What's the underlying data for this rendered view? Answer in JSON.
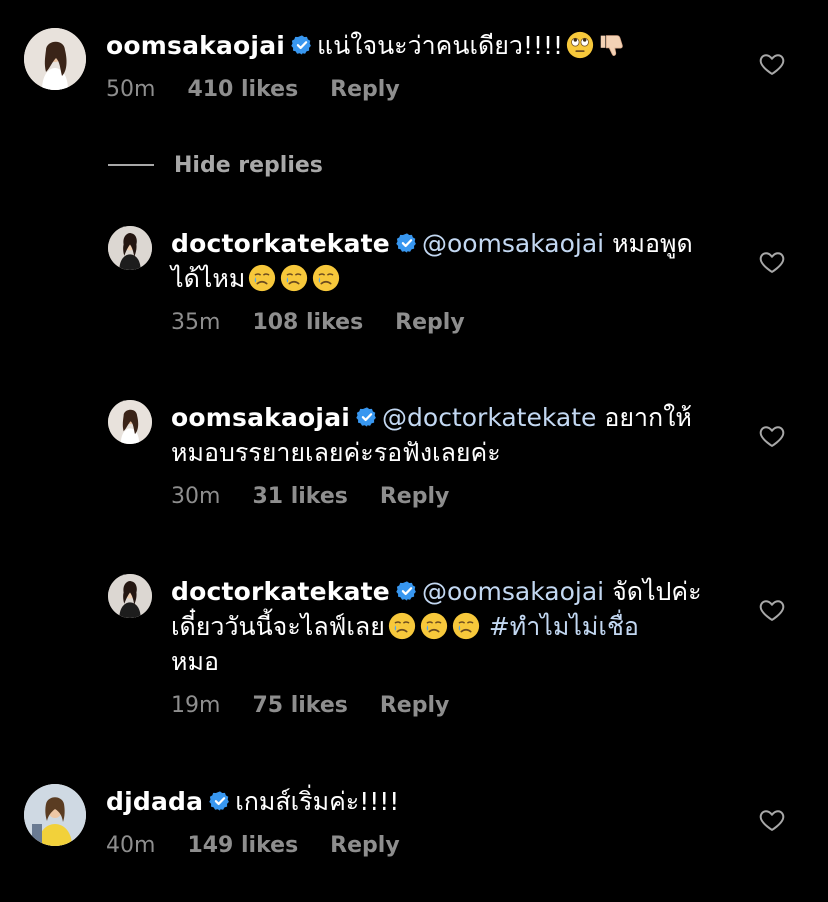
{
  "comments": [
    {
      "username": "oomsakaojai",
      "text": "แน่ใจนะว่าคนเดียว!!!!",
      "emoji": [
        "eye-roll",
        "thumbs-down"
      ],
      "time": "50m",
      "likes": "410 likes",
      "reply": "Reply"
    }
  ],
  "hide_replies": "Hide replies",
  "replies": [
    {
      "username": "doctorkatekate",
      "mention": "@oomsakaojai",
      "text_line1": "หมอพูด",
      "text_line2": "ได้ไหม",
      "emoji": [
        "crying",
        "crying",
        "crying"
      ],
      "time": "35m",
      "likes": "108 likes",
      "reply": "Reply"
    },
    {
      "username": "oomsakaojai",
      "mention": "@doctorkatekate",
      "text_line1": "อยากให้",
      "text_line2": "หมอบรรยายเลยค่ะรอฟังเลยค่ะ",
      "time": "30m",
      "likes": "31 likes",
      "reply": "Reply"
    },
    {
      "username": "doctorkatekate",
      "mention": "@oomsakaojai",
      "text_line1": "จัดไปค่ะ",
      "text_line2": "เดี๋ยววันนี้จะไลฟ์เลย",
      "hashtag": "#ทำไมไม่เชื่อ",
      "text_line3": "หมอ",
      "emoji": [
        "crying",
        "crying",
        "crying"
      ],
      "time": "19m",
      "likes": "75 likes",
      "reply": "Reply"
    }
  ],
  "last_comment": {
    "username": "djdada",
    "text": "เกมส์เริ่มค่ะ!!!!",
    "time": "40m",
    "likes": "149 likes",
    "reply": "Reply"
  },
  "colors": {
    "background": "#000000",
    "verified": "#3897f0",
    "mention": "#c3d8f2",
    "meta": "#8e8e8e"
  }
}
